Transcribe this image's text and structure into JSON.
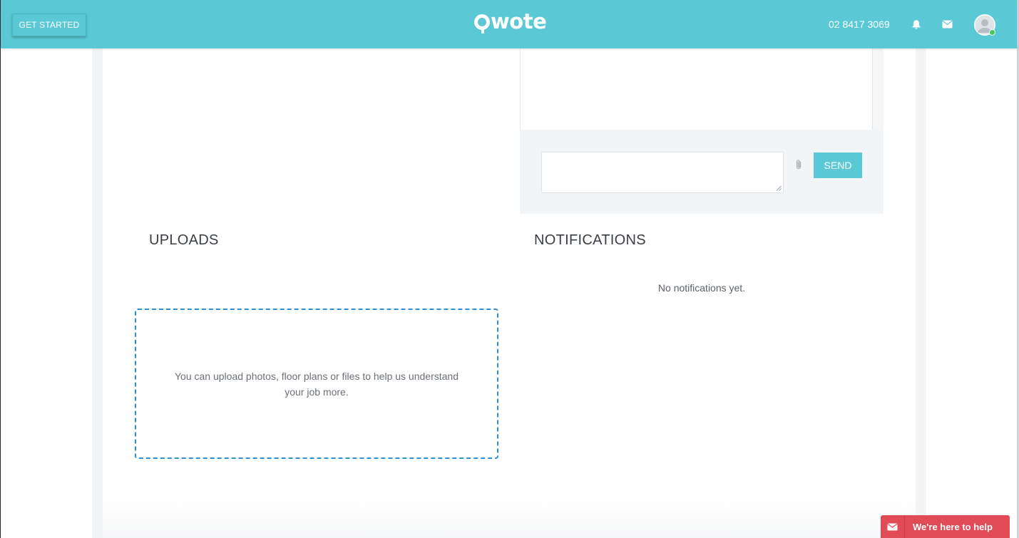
{
  "header": {
    "get_started_label": "GET STARTED",
    "logo_text": "wote",
    "phone": "02 8417 3069",
    "icons": [
      "bell-icon",
      "mail-icon",
      "avatar"
    ],
    "accent_color": "#5bc8d5"
  },
  "chat": {
    "send_label": "SEND",
    "input_value": "",
    "icons": [
      "paperclip-icon"
    ]
  },
  "uploads": {
    "title": "UPLOADS",
    "dropzone_text": "You can upload photos, floor plans or files to help us understand your job more."
  },
  "notifications": {
    "title": "NOTIFICATIONS",
    "empty_text": "No notifications yet."
  },
  "help_widget": {
    "label": "We're here to help",
    "color": "#e04b55"
  }
}
